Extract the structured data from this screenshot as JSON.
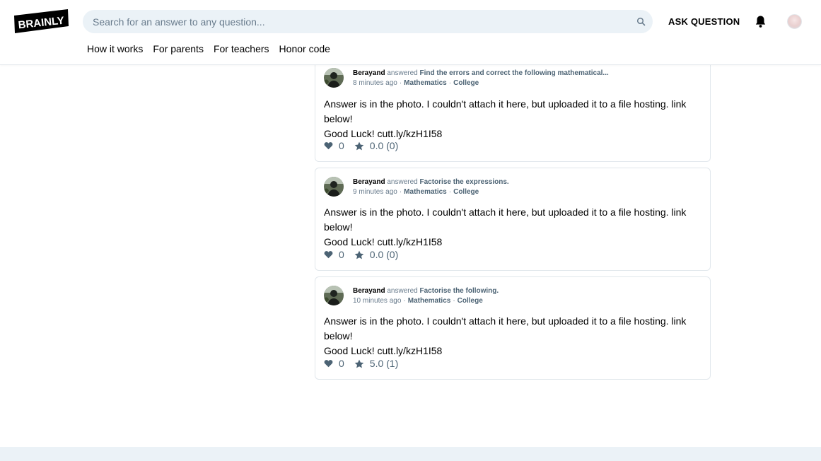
{
  "brand": {
    "logo_text": "BRAINLY"
  },
  "search": {
    "placeholder": "Search for an answer to any question..."
  },
  "header": {
    "ask_label": "ASK QUESTION",
    "nav": [
      "How it works",
      "For parents",
      "For teachers",
      "Honor code"
    ]
  },
  "answers": [
    {
      "author": "Berayand",
      "verb": "answered",
      "question": "Find the errors and correct the following mathematical...",
      "time": "8 minutes ago",
      "subject": "Mathematics",
      "level": "College",
      "text_line1": "Answer is in the photo. I couldn't attach it here, but uploaded it to a file hosting. link below!",
      "text_line2": "Good Luck! cutt.ly/kzH1I58",
      "likes": "0",
      "rating": "0.0 (0)"
    },
    {
      "author": "Berayand",
      "verb": "answered",
      "question": "Factorise the expressions.",
      "time": "9 minutes ago",
      "subject": "Mathematics",
      "level": "College",
      "text_line1": "Answer is in the photo. I couldn't attach it here, but uploaded it to a file hosting. link below!",
      "text_line2": "Good Luck! cutt.ly/kzH1I58",
      "likes": "0",
      "rating": "0.0 (0)"
    },
    {
      "author": "Berayand",
      "verb": "answered",
      "question": "Factorise the following.",
      "time": "10 minutes ago",
      "subject": "Mathematics",
      "level": "College",
      "text_line1": "Answer is in the photo. I couldn't attach it here, but uploaded it to a file hosting. link below!",
      "text_line2": "Good Luck! cutt.ly/kzH1I58",
      "likes": "0",
      "rating": "5.0 (1)"
    }
  ],
  "icons": {
    "search": "search-icon",
    "bell": "bell-icon",
    "heart": "heart-icon",
    "star": "star-icon"
  },
  "colors": {
    "search_bg": "#ebf2f7",
    "muted": "#687b8c",
    "link": "#4c6374",
    "border": "#e1e7ec"
  }
}
